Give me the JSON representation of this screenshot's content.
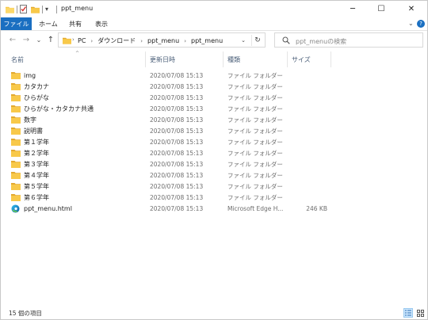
{
  "window": {
    "title": "ppt_menu",
    "quick_access_dropdown": "▾",
    "controls": {
      "minimize": "─",
      "maximize": "☐",
      "close": "✕"
    }
  },
  "ribbon": {
    "file_tab": "ファイル",
    "tabs": [
      "ホーム",
      "共有",
      "表示"
    ],
    "expand": "⌄",
    "help": "?"
  },
  "nav": {
    "back": "←",
    "forward": "→",
    "recent": "⌄",
    "up": "↑"
  },
  "address": {
    "crumbs": [
      "PC",
      "ダウンロード",
      "ppt_menu",
      "ppt_menu"
    ],
    "separator": "›",
    "dropdown": "⌄",
    "refresh": "↻"
  },
  "search": {
    "placeholder": "ppt_menuの検索"
  },
  "columns": {
    "name": "名前",
    "date": "更新日時",
    "type": "種類",
    "size": "サイズ",
    "sort_caret": "^"
  },
  "files": [
    {
      "name": "img",
      "date": "2020/07/08 15:13",
      "type": "ファイル フォルダー",
      "size": "",
      "icon": "folder-icon"
    },
    {
      "name": "カタカナ",
      "date": "2020/07/08 15:13",
      "type": "ファイル フォルダー",
      "size": "",
      "icon": "folder-icon"
    },
    {
      "name": "ひらがな",
      "date": "2020/07/08 15:13",
      "type": "ファイル フォルダー",
      "size": "",
      "icon": "folder-icon"
    },
    {
      "name": "ひらがな・カタカナ共通",
      "date": "2020/07/08 15:13",
      "type": "ファイル フォルダー",
      "size": "",
      "icon": "folder-icon"
    },
    {
      "name": "数字",
      "date": "2020/07/08 15:13",
      "type": "ファイル フォルダー",
      "size": "",
      "icon": "folder-icon"
    },
    {
      "name": "説明書",
      "date": "2020/07/08 15:13",
      "type": "ファイル フォルダー",
      "size": "",
      "icon": "folder-icon"
    },
    {
      "name": "第１学年",
      "date": "2020/07/08 15:13",
      "type": "ファイル フォルダー",
      "size": "",
      "icon": "folder-icon"
    },
    {
      "name": "第２学年",
      "date": "2020/07/08 15:13",
      "type": "ファイル フォルダー",
      "size": "",
      "icon": "folder-icon"
    },
    {
      "name": "第３学年",
      "date": "2020/07/08 15:13",
      "type": "ファイル フォルダー",
      "size": "",
      "icon": "folder-icon"
    },
    {
      "name": "第４学年",
      "date": "2020/07/08 15:13",
      "type": "ファイル フォルダー",
      "size": "",
      "icon": "folder-icon"
    },
    {
      "name": "第５学年",
      "date": "2020/07/08 15:13",
      "type": "ファイル フォルダー",
      "size": "",
      "icon": "folder-icon"
    },
    {
      "name": "第６学年",
      "date": "2020/07/08 15:13",
      "type": "ファイル フォルダー",
      "size": "",
      "icon": "folder-icon"
    },
    {
      "name": "ppt_menu.html",
      "date": "2020/07/08 15:13",
      "type": "Microsoft Edge H...",
      "size": "246 KB",
      "icon": "edge-icon"
    }
  ],
  "status": {
    "item_count": "15 個の項目"
  },
  "colors": {
    "accent": "#1a6fc1",
    "folder": "#f8c94a",
    "folder_dark": "#e3a92f",
    "header_text": "#4c607a"
  }
}
